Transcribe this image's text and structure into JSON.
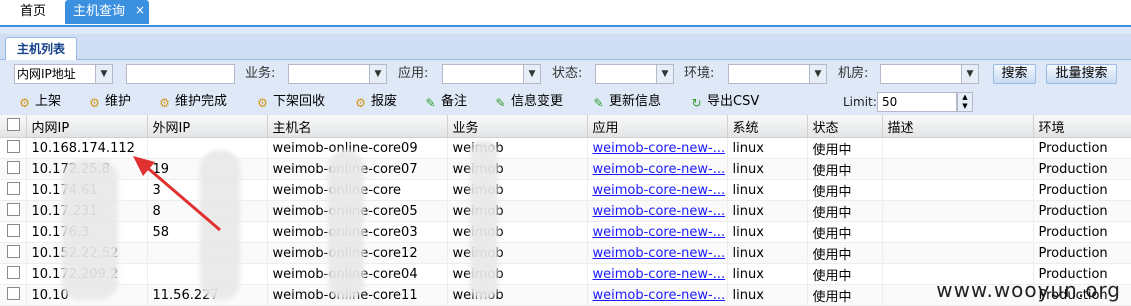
{
  "top_tabs": {
    "home": "首页",
    "host_query": "主机查询",
    "close_glyph": "×"
  },
  "panel": {
    "tab_label": "主机列表"
  },
  "search": {
    "field_select": "内网IP地址",
    "field_value": "",
    "business_label": "业务:",
    "app_label": "应用:",
    "status_label": "状态:",
    "env_label": "环境:",
    "room_label": "机房:",
    "search_button": "搜索",
    "batch_search_button": "批量搜索"
  },
  "toolbar": {
    "items": [
      {
        "label": "上架",
        "icon": "gear-icon"
      },
      {
        "label": "维护",
        "icon": "gear-icon"
      },
      {
        "label": "维护完成",
        "icon": "gear-icon"
      },
      {
        "label": "下架回收",
        "icon": "gear-icon"
      },
      {
        "label": "报废",
        "icon": "gear-icon"
      },
      {
        "label": "备注",
        "icon": "edit-icon"
      },
      {
        "label": "信息变更",
        "icon": "edit-icon"
      },
      {
        "label": "更新信息",
        "icon": "edit-icon"
      },
      {
        "label": "导出CSV",
        "icon": "refresh-icon"
      }
    ],
    "limit_label": "Limit:",
    "limit_value": "50"
  },
  "grid": {
    "columns": [
      "内网IP",
      "外网IP",
      "主机名",
      "业务",
      "应用",
      "系统",
      "状态",
      "描述",
      "环境"
    ],
    "rows": [
      [
        "10.168.174.112",
        "",
        "weimob-online-core09",
        "weimob",
        "weimob-core-new-...",
        "linux",
        "使用中",
        "",
        "Production"
      ],
      [
        "10.172.25.8",
        "19",
        "weimob-online-core07",
        "weimob",
        "weimob-core-new-...",
        "linux",
        "使用中",
        "",
        "Production"
      ],
      [
        "10.174.61",
        "3",
        "weimob-online-core",
        "weimob",
        "weimob-core-new-...",
        "linux",
        "使用中",
        "",
        "Production"
      ],
      [
        "10.17.231",
        "8",
        "weimob-online-core05",
        "weimob",
        "weimob-core-new-...",
        "linux",
        "使用中",
        "",
        "Production"
      ],
      [
        "10.176.3",
        "58",
        "weimob-online-core03",
        "weimob",
        "weimob-core-new-...",
        "linux",
        "使用中",
        "",
        "Production"
      ],
      [
        "10.152.22.52",
        "",
        "weimob-online-core12",
        "weimob",
        "weimob-core-new-...",
        "linux",
        "使用中",
        "",
        "Production"
      ],
      [
        "10.172.209.2",
        "",
        "weimob-online-core04",
        "weimob",
        "weimob-core-new-...",
        "linux",
        "使用中",
        "",
        "Production"
      ],
      [
        "10.10",
        "11.56.227",
        "weimob-online-core11",
        "weimob",
        "weimob-core-new-...",
        "linux",
        "使用中",
        "",
        "Production"
      ]
    ]
  },
  "watermark": "www.wooyun.org",
  "colors": {
    "accent": "#3b90e0",
    "arrow": "#e03030",
    "link": "#1a1aff"
  }
}
